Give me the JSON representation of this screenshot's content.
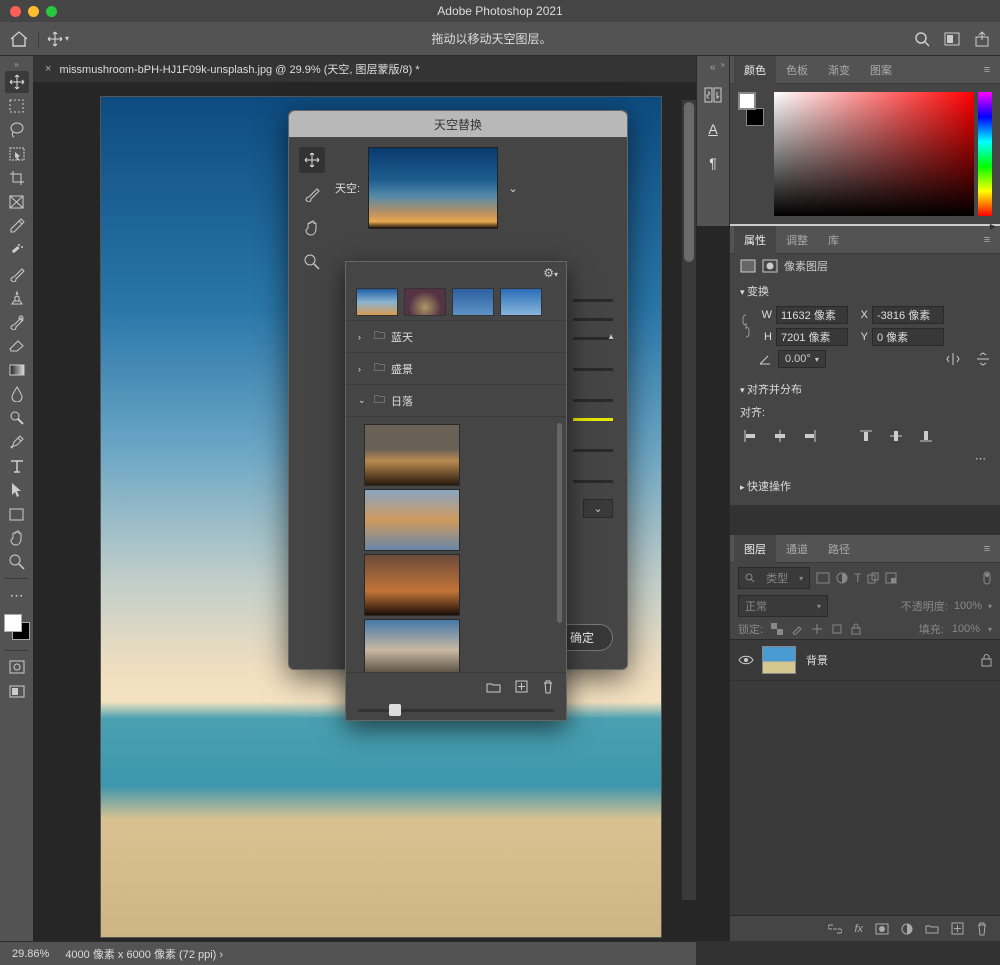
{
  "app": {
    "title": "Adobe Photoshop 2021"
  },
  "optbar": {
    "hint": "拖动以移动天空图层。"
  },
  "document": {
    "tab_label": "missmushroom-bPH-HJ1F09k-unsplash.jpg @ 29.9% (天空, 图层蒙版/8) *"
  },
  "rail": {
    "t1": "⇄",
    "t2": "A",
    "t3": "¶"
  },
  "panels": {
    "color": {
      "tab_color": "颜色",
      "tab_swatch": "色板",
      "tab_grad": "渐变",
      "tab_pattern": "图案"
    },
    "props": {
      "tab_props": "属性",
      "tab_adjust": "调整",
      "tab_lib": "库",
      "kind": "像素图层",
      "sec_transform": "变换",
      "W_label": "W",
      "W_value": "11632 像素",
      "X_label": "X",
      "X_value": "-3816 像素",
      "H_label": "H",
      "H_value": "7201 像素",
      "Y_label": "Y",
      "Y_value": "0 像素",
      "angle": "0.00°",
      "sec_align": "对齐并分布",
      "align_label": "对齐:",
      "sec_quick": "快速操作"
    },
    "layers": {
      "tab_layers": "图层",
      "tab_channels": "通道",
      "tab_paths": "路径",
      "filter": "类型",
      "blend": "正常",
      "opacity_label": "不透明度:",
      "opacity_value": "100%",
      "lock_label": "锁定:",
      "fill_label": "填充:",
      "fill_value": "100%",
      "layer1_name": "背景"
    }
  },
  "dialog": {
    "title": "天空替换",
    "sky_label": "天空:",
    "ok": "确定"
  },
  "flyout": {
    "folder_blue": "蓝天",
    "folder_spec": "盛景",
    "folder_sunset": "日落"
  },
  "status": {
    "zoom": "29.86%",
    "dims": "4000 像素 x 6000 像素 (72 ppi)  ›"
  }
}
